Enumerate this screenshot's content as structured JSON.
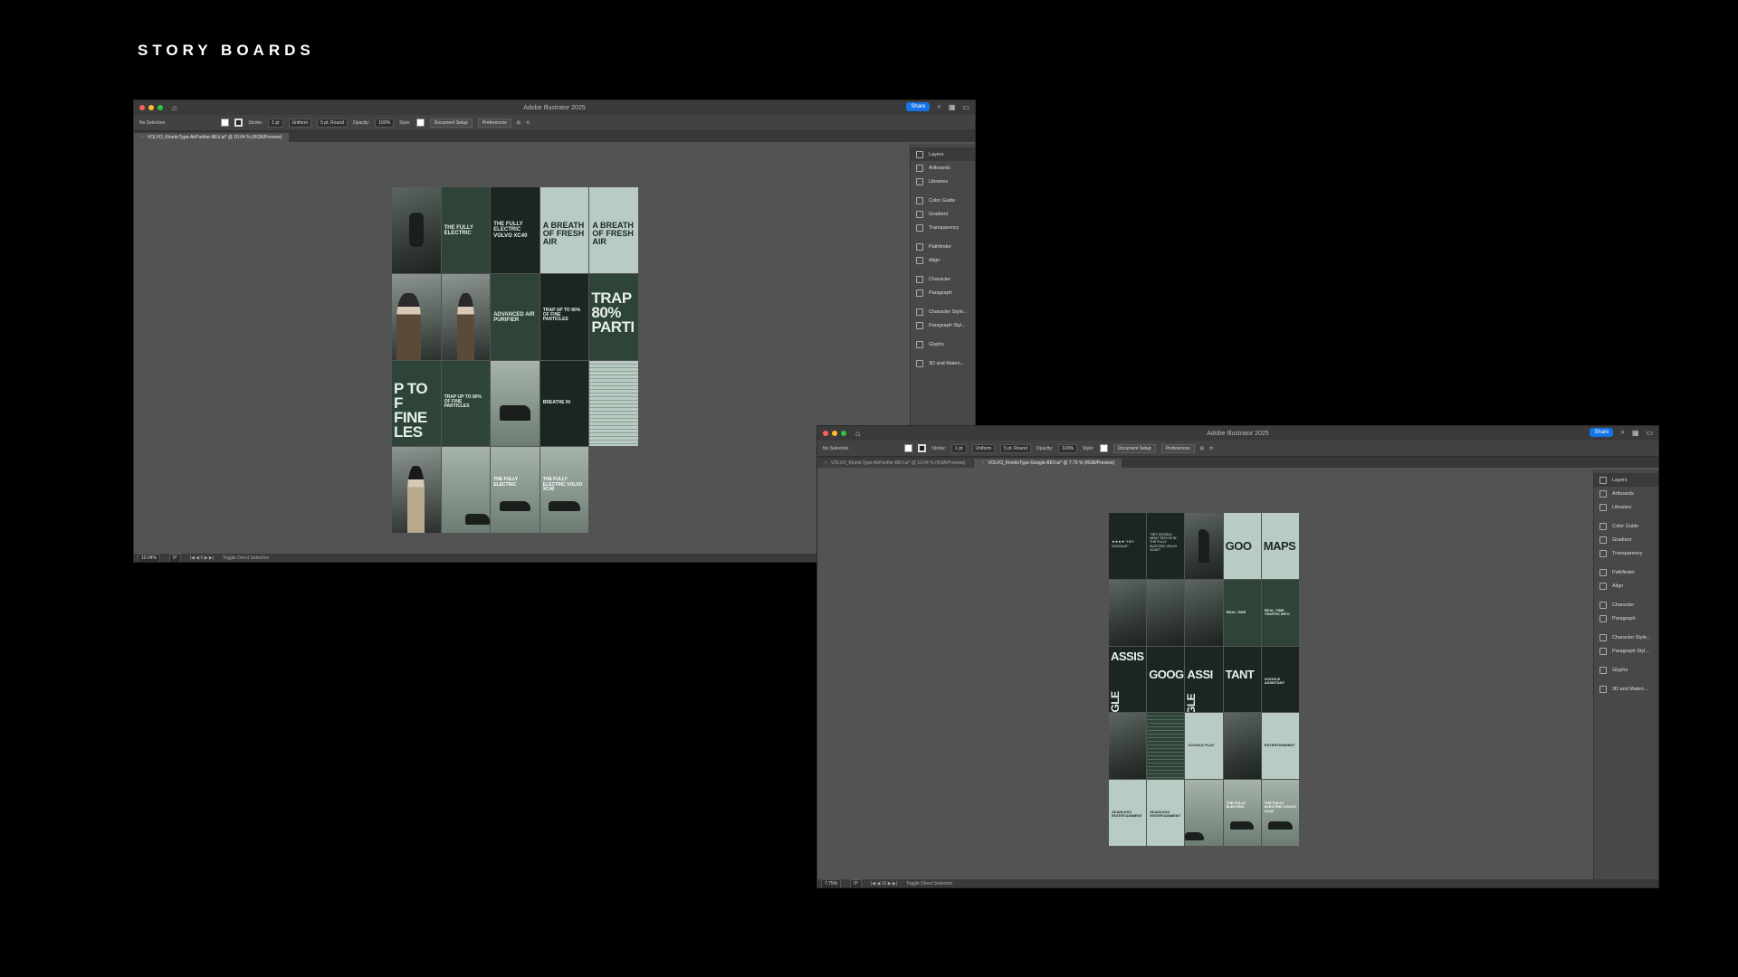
{
  "page": {
    "title": "STORY BOARDS"
  },
  "colors": {
    "accent": "#1473e6",
    "canvas": "#535353",
    "dark_green": "#2e4438",
    "light_green": "#b9ccc3"
  },
  "app_title_1": "Adobe Illustrator 2025",
  "app_title_2": "Adobe Illustrator 2025",
  "controls": {
    "selection": "No Selection",
    "stroke_label": "Stroke:",
    "stroke_value": "1 pt",
    "profile": "Uniform",
    "brush": "5 pt. Round",
    "opacity_label": "Opacity:",
    "opacity_value": "100%",
    "style_label": "Style:",
    "document_setup": "Document Setup",
    "preferences": "Preferences",
    "share": "Share"
  },
  "window1": {
    "tabs": [
      {
        "label": "VOLVO_KineticType-AirPurifier-BEV.ai* @ 10.04 % (RGB/Preview)"
      }
    ],
    "status": {
      "zoom": "10.04%",
      "angle": "0°",
      "artboard": "5",
      "tool": "Toggle Direct Selection"
    }
  },
  "window2": {
    "tabs": [
      {
        "label": "VOLVO_KineticType-AirPurifier-BEV.ai* @ 10.04 % (RGB/Preview)"
      },
      {
        "label": "VOLVO_KineticType-Google-BEV.ai* @ 7.75 % (RGB/Preview)"
      }
    ],
    "status": {
      "zoom": "7.75%",
      "angle": "0°",
      "artboard": "16",
      "tool": "Toggle Direct Selection"
    }
  },
  "panels": [
    {
      "label": "Layers",
      "icon": "layers-icon"
    },
    {
      "label": "Artboards",
      "icon": "artboards-icon"
    },
    {
      "label": "Libraries",
      "icon": "libraries-icon"
    },
    {
      "label": "Color Guide",
      "icon": "color-guide-icon"
    },
    {
      "label": "Gradient",
      "icon": "gradient-icon"
    },
    {
      "label": "Transparency",
      "icon": "transparency-icon"
    },
    {
      "label": "Pathfinder",
      "icon": "pathfinder-icon"
    },
    {
      "label": "Align",
      "icon": "align-icon"
    },
    {
      "label": "Character",
      "icon": "character-icon"
    },
    {
      "label": "Paragraph",
      "icon": "paragraph-icon"
    },
    {
      "label": "Character Style...",
      "icon": "character-style-icon"
    },
    {
      "label": "Paragraph Styl...",
      "icon": "paragraph-style-icon"
    },
    {
      "label": "Glyphs",
      "icon": "glyphs-icon"
    },
    {
      "label": "3D and Materi...",
      "icon": "3d-icon"
    }
  ],
  "board1": {
    "r1c2": "THE FULLY ELECTRIC",
    "r1c3": "THE FULLY ELECTRIC VOLVO XC40",
    "r1c4": "A BREATH OF FRESH AIR",
    "r1c5": "A BREATH OF FRESH AIR",
    "r2c3": "ADVANCED AIR PURIFIER",
    "r2c4": "TRAP UP TO 80% OF FINE PARTICLES",
    "r2c5": "TRAP 80% PARTI",
    "r3c1": "P TO F FINE LES",
    "r3c2": "TRAP UP TO 80% OF FINE PARTICLES",
    "r3c4": "BREATHE IN",
    "r4c3": "THE FULLY ELECTRIC",
    "r4c4": "THE FULLY ELECTRIC VOLVO XC40"
  },
  "board2": {
    "r1c2": "\"HEY GOOGLE, WHAT TECH IS IN THE FULLY ELECTRIC VOLVO XC40?\"",
    "r1c4": "GOO",
    "r1c5": "MAPS",
    "r2c4": "REAL-TIME",
    "r2c5": "REAL-TIME TRAFFIC INFO",
    "r3c1": "ASSIS",
    "r3c1v": "GOOGLE",
    "r3c2": "GOOG",
    "r3c3": "ASSI",
    "r3c3v": "GLE",
    "r3c4": "TANT",
    "r3c5": "GOOGLE ASSISTANT",
    "r4c3": "GOOGLE PLAY",
    "r4c5": "ENTERTAINMENT",
    "r5c1": "SEAMLESS ENTERTAINMENT",
    "r5c2": "SEAMLESS ENTERTAINMENT",
    "r5c4": "THE FULLY ELECTRIC",
    "r5c5": "THE FULLY ELECTRIC VOLVO XC40"
  }
}
